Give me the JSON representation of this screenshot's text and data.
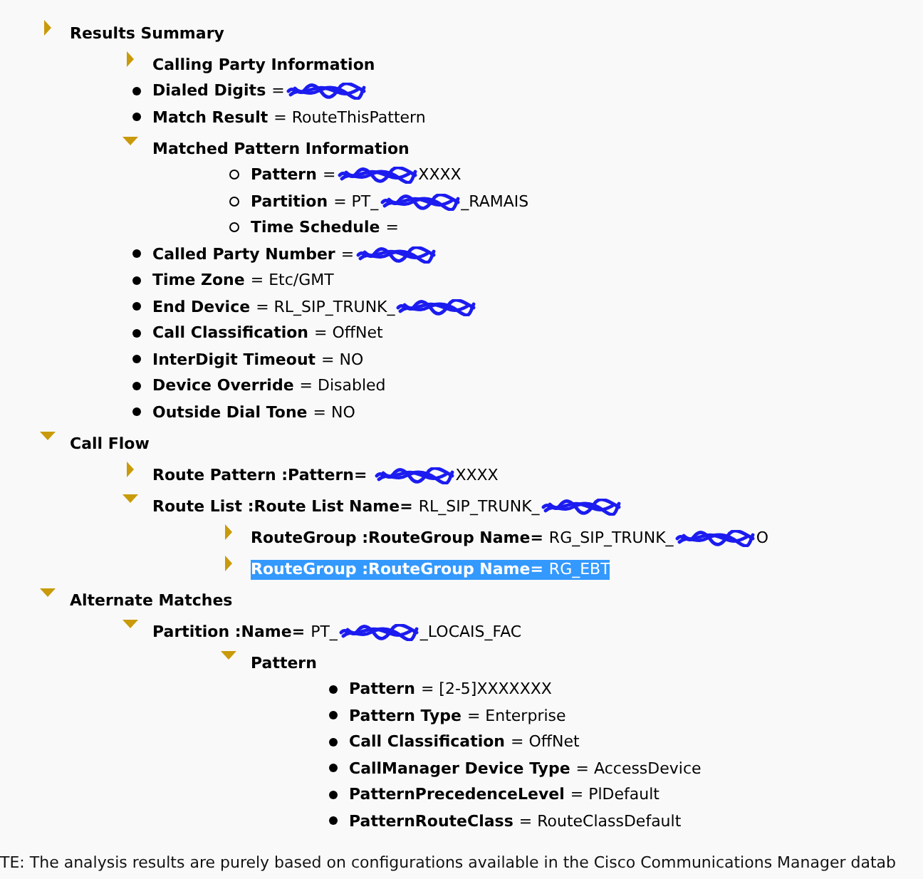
{
  "tree": [
    {
      "kind": "node",
      "label": "Results Summary",
      "expanded": false,
      "children": [
        {
          "kind": "node",
          "label": "Calling Party Information",
          "expanded": false
        },
        {
          "kind": "disc",
          "label": "Dialed Digits",
          "value": [
            {
              "kind": "text",
              "text": "="
            },
            {
              "kind": "redacted"
            }
          ]
        },
        {
          "kind": "disc",
          "label": "Match Result",
          "value": [
            {
              "kind": "text",
              "text": "= RouteThisPattern"
            }
          ]
        },
        {
          "kind": "node",
          "label": "Matched Pattern Information",
          "expanded": true,
          "children": [
            {
              "kind": "ring",
              "label": "Pattern",
              "value": [
                {
                  "kind": "text",
                  "text": "="
                },
                {
                  "kind": "redacted"
                },
                {
                  "kind": "text",
                  "text": "XXXX"
                }
              ]
            },
            {
              "kind": "ring",
              "label": "Partition",
              "value": [
                {
                  "kind": "text",
                  "text": "= PT_"
                },
                {
                  "kind": "redacted"
                },
                {
                  "kind": "text",
                  "text": "_RAMAIS"
                }
              ]
            },
            {
              "kind": "ring",
              "label": "Time Schedule",
              "value": [
                {
                  "kind": "text",
                  "text": "="
                }
              ]
            }
          ]
        },
        {
          "kind": "disc",
          "label": "Called Party Number",
          "value": [
            {
              "kind": "text",
              "text": "="
            },
            {
              "kind": "redacted"
            }
          ]
        },
        {
          "kind": "disc",
          "label": "Time Zone",
          "value": [
            {
              "kind": "text",
              "text": "= Etc/GMT"
            }
          ]
        },
        {
          "kind": "disc",
          "label": "End Device",
          "value": [
            {
              "kind": "text",
              "text": "= RL_SIP_TRUNK_"
            },
            {
              "kind": "redacted"
            }
          ]
        },
        {
          "kind": "disc",
          "label": "Call Classification",
          "value": [
            {
              "kind": "text",
              "text": "= OffNet"
            }
          ]
        },
        {
          "kind": "disc",
          "label": "InterDigit Timeout",
          "value": [
            {
              "kind": "text",
              "text": "= NO"
            }
          ]
        },
        {
          "kind": "disc",
          "label": "Device Override",
          "value": [
            {
              "kind": "text",
              "text": "= Disabled"
            }
          ]
        },
        {
          "kind": "disc",
          "label": "Outside Dial Tone",
          "value": [
            {
              "kind": "text",
              "text": "= NO"
            }
          ]
        }
      ]
    },
    {
      "kind": "node",
      "label": "Call Flow",
      "expanded": true,
      "children": [
        {
          "kind": "node",
          "label": "Route Pattern :Pattern=",
          "expanded": false,
          "value": [
            {
              "kind": "redacted"
            },
            {
              "kind": "text",
              "text": "XXXX"
            }
          ]
        },
        {
          "kind": "node",
          "label": "Route List :Route List Name=",
          "expanded": true,
          "value": [
            {
              "kind": "text",
              "text": "RL_SIP_TRUNK_"
            },
            {
              "kind": "redacted"
            }
          ],
          "children": [
            {
              "kind": "node",
              "label": "RouteGroup :RouteGroup Name=",
              "expanded": false,
              "selected": false,
              "value": [
                {
                  "kind": "text",
                  "text": "RG_SIP_TRUNK_"
                },
                {
                  "kind": "redacted"
                },
                {
                  "kind": "text",
                  "text": "O"
                }
              ]
            },
            {
              "kind": "node",
              "label": "RouteGroup :RouteGroup Name=",
              "expanded": false,
              "selected": true,
              "value": [
                {
                  "kind": "text",
                  "text": "RG_EBT"
                }
              ]
            }
          ]
        }
      ]
    },
    {
      "kind": "node",
      "label": "Alternate Matches",
      "expanded": true,
      "children": [
        {
          "kind": "node",
          "label": "Partition :Name=",
          "expanded": true,
          "value": [
            {
              "kind": "text",
              "text": "PT_"
            },
            {
              "kind": "redacted"
            },
            {
              "kind": "text",
              "text": "_LOCAIS_FAC"
            }
          ],
          "children": [
            {
              "kind": "node",
              "label": "Pattern",
              "expanded": true,
              "children": [
                {
                  "kind": "disc",
                  "label": "Pattern",
                  "value": [
                    {
                      "kind": "text",
                      "text": "= [2-5]XXXXXXX"
                    }
                  ]
                },
                {
                  "kind": "disc",
                  "label": "Pattern Type",
                  "value": [
                    {
                      "kind": "text",
                      "text": "= Enterprise"
                    }
                  ]
                },
                {
                  "kind": "disc",
                  "label": "Call Classification",
                  "value": [
                    {
                      "kind": "text",
                      "text": "= OffNet"
                    }
                  ]
                },
                {
                  "kind": "disc",
                  "label": "CallManager Device Type",
                  "value": [
                    {
                      "kind": "text",
                      "text": "= AccessDevice"
                    }
                  ]
                },
                {
                  "kind": "disc",
                  "label": "PatternPrecedenceLevel",
                  "value": [
                    {
                      "kind": "text",
                      "text": "= PlDefault"
                    }
                  ]
                },
                {
                  "kind": "disc",
                  "label": "PatternRouteClass",
                  "value": [
                    {
                      "kind": "text",
                      "text": "= RouteClassDefault"
                    }
                  ]
                }
              ]
            }
          ]
        }
      ]
    }
  ],
  "note": "TE: The analysis results are purely based on configurations available in the Cisco Communications Manager datab"
}
